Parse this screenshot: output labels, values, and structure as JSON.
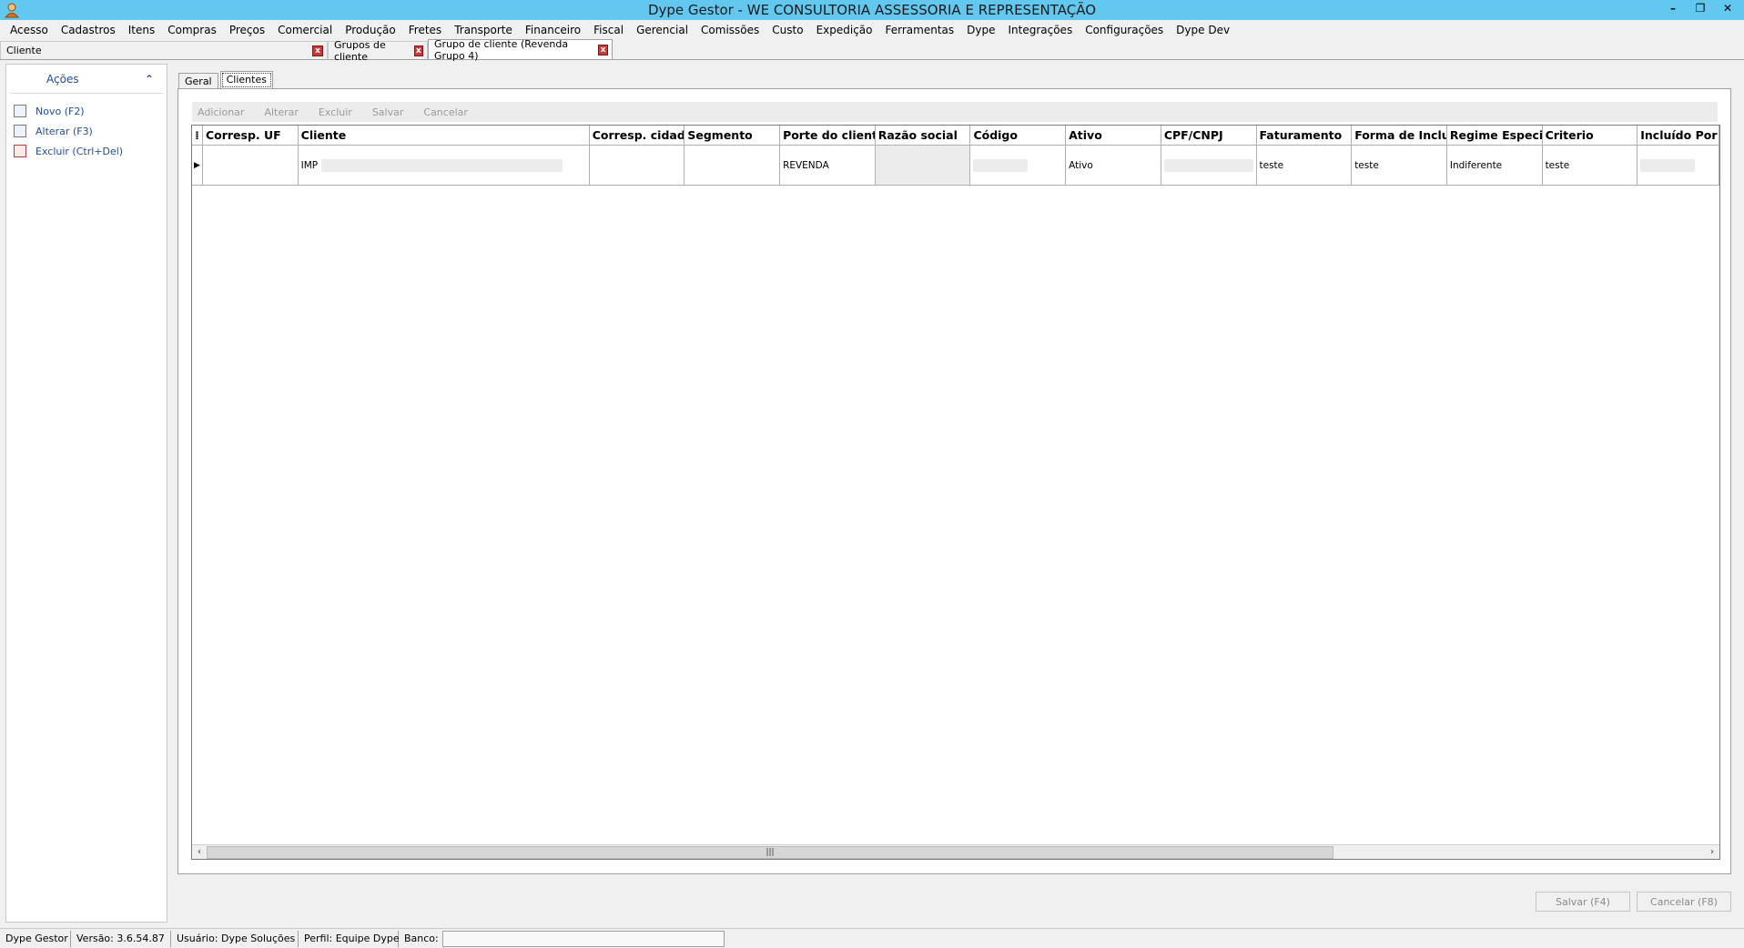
{
  "window": {
    "title": "Dype Gestor - WE CONSULTORIA ASSESSORIA E REPRESENTAÇÃO",
    "icon": "app-person-icon",
    "controls": [
      "minimize-icon",
      "restore-icon",
      "close-icon"
    ]
  },
  "menu": [
    "Acesso",
    "Cadastros",
    "Itens",
    "Compras",
    "Preços",
    "Comercial",
    "Produção",
    "Fretes",
    "Transporte",
    "Financeiro",
    "Fiscal",
    "Gerencial",
    "Comissões",
    "Custo",
    "Expedição",
    "Ferramentas",
    "Dype",
    "Integrações",
    "Configurações",
    "Dype Dev"
  ],
  "doc_tabs": [
    {
      "label": "Cliente",
      "active": false
    },
    {
      "label": "Grupos de cliente",
      "active": false
    },
    {
      "label": "Grupo de cliente (Revenda Grupo 4)",
      "active": true
    }
  ],
  "left_panel": {
    "title": "Ações",
    "actions": [
      {
        "label": "Novo (F2)",
        "icon": "new-document-icon"
      },
      {
        "label": "Alterar (F3)",
        "icon": "edit-document-icon"
      },
      {
        "label": "Excluir (Ctrl+Del)",
        "icon": "delete-document-icon"
      }
    ]
  },
  "inner_tabs": [
    {
      "label": "Geral",
      "active": false
    },
    {
      "label": "Clientes",
      "active": true
    }
  ],
  "grid_toolbar": [
    "Adicionar",
    "Alterar",
    "Excluir",
    "Salvar",
    "Cancelar"
  ],
  "grid": {
    "columns": [
      "Corresp. UF",
      "Cliente",
      "Corresp. cidade",
      "Segmento",
      "Porte do cliente",
      "Razão social",
      "Código",
      "Ativo",
      "CPF/CNPJ",
      "Faturamento",
      "Forma de Inclusão",
      "Regime Especial",
      "Criterio",
      "Incluído Por"
    ],
    "rows": [
      [
        "",
        "IMP",
        "",
        "",
        "REVENDA",
        "",
        "",
        "Ativo",
        "",
        "teste",
        "teste",
        "Indiferente",
        "teste",
        ""
      ]
    ]
  },
  "footer_buttons": {
    "save": "Salvar (F4)",
    "cancel": "Cancelar (F8)"
  },
  "status": {
    "app": "Dype Gestor",
    "version": "Versão: 3.6.54.87",
    "user": "Usuário: Dype Soluções",
    "profile": "Perfil: Equipe Dype",
    "bank": "Banco:"
  }
}
